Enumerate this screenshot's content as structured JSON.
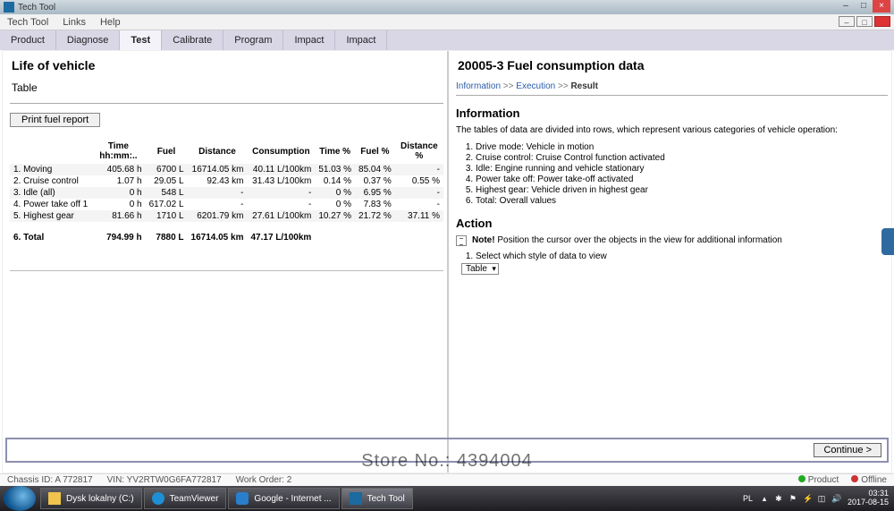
{
  "window": {
    "title": "Tech Tool"
  },
  "menubar": {
    "items": [
      "Tech Tool",
      "Links",
      "Help"
    ]
  },
  "tabs": [
    {
      "label": "Product"
    },
    {
      "label": "Diagnose"
    },
    {
      "label": "Test"
    },
    {
      "label": "Calibrate"
    },
    {
      "label": "Program"
    },
    {
      "label": "Impact"
    },
    {
      "label": "Impact"
    }
  ],
  "left": {
    "title": "Life of vehicle",
    "subtitle": "Table",
    "print_label": "Print fuel report",
    "columns": [
      "",
      "Time hh:mm:..",
      "Fuel",
      "Distance",
      "Consumption",
      "Time %",
      "Fuel %",
      "Distance %"
    ],
    "rows": [
      {
        "label": "1. Moving",
        "time": "405.68 h",
        "fuel": "6700 L",
        "dist": "16714.05 km",
        "cons": "40.11 L/100km",
        "tpct": "51.03 %",
        "fpct": "85.04 %",
        "dpct": "-"
      },
      {
        "label": "2. Cruise control",
        "time": "1.07 h",
        "fuel": "29.05 L",
        "dist": "92.43 km",
        "cons": "31.43 L/100km",
        "tpct": "0.14 %",
        "fpct": "0.37 %",
        "dpct": "0.55 %"
      },
      {
        "label": "3. Idle (all)",
        "time": "0 h",
        "fuel": "548 L",
        "dist": "-",
        "cons": "-",
        "tpct": "0 %",
        "fpct": "6.95 %",
        "dpct": "-"
      },
      {
        "label": "4. Power take off 1",
        "time": "0 h",
        "fuel": "617.02 L",
        "dist": "-",
        "cons": "-",
        "tpct": "0 %",
        "fpct": "7.83 %",
        "dpct": "-"
      },
      {
        "label": "5. Highest gear",
        "time": "81.66 h",
        "fuel": "1710 L",
        "dist": "6201.79 km",
        "cons": "27.61 L/100km",
        "tpct": "10.27 %",
        "fpct": "21.72 %",
        "dpct": "37.11 %"
      }
    ],
    "total": {
      "label": "6. Total",
      "time": "794.99 h",
      "fuel": "7880 L",
      "dist": "16714.05 km",
      "cons": "47.17 L/100km"
    }
  },
  "right": {
    "title": "20005-3 Fuel consumption data",
    "breadcrumb": {
      "a": "Information",
      "b": "Execution",
      "c": "Result"
    },
    "info_title": "Information",
    "info_text": "The tables of data are divided into rows, which represent various categories of vehicle operation:",
    "info_items": [
      "Drive mode: Vehicle in motion",
      "Cruise control: Cruise Control function activated",
      "Idle: Engine running and vehicle stationary",
      "Power take off: Power take-off activated",
      "Highest gear: Vehicle driven in highest gear",
      "Total: Overall values"
    ],
    "action_title": "Action",
    "note_label": "Note!",
    "note_text": "Position the cursor over the objects in the view for additional information",
    "action_items": [
      "Select which style of data to view"
    ],
    "select_value": "Table",
    "continue_label": "Continue >"
  },
  "status": {
    "chassis": "Chassis ID: A 772817",
    "vin": "VIN: YV2RTW0G6FA772817",
    "work_order": "Work Order: 2",
    "product": "Product",
    "offline": "Offline"
  },
  "taskbar": {
    "items": [
      {
        "label": "Dysk lokalny (C:)"
      },
      {
        "label": "TeamViewer"
      },
      {
        "label": "Google - Internet ..."
      },
      {
        "label": "Tech Tool"
      }
    ],
    "lang": "PL",
    "time": "03:31",
    "date": "2017-08-15"
  },
  "watermark": "Store No.: 4394004"
}
